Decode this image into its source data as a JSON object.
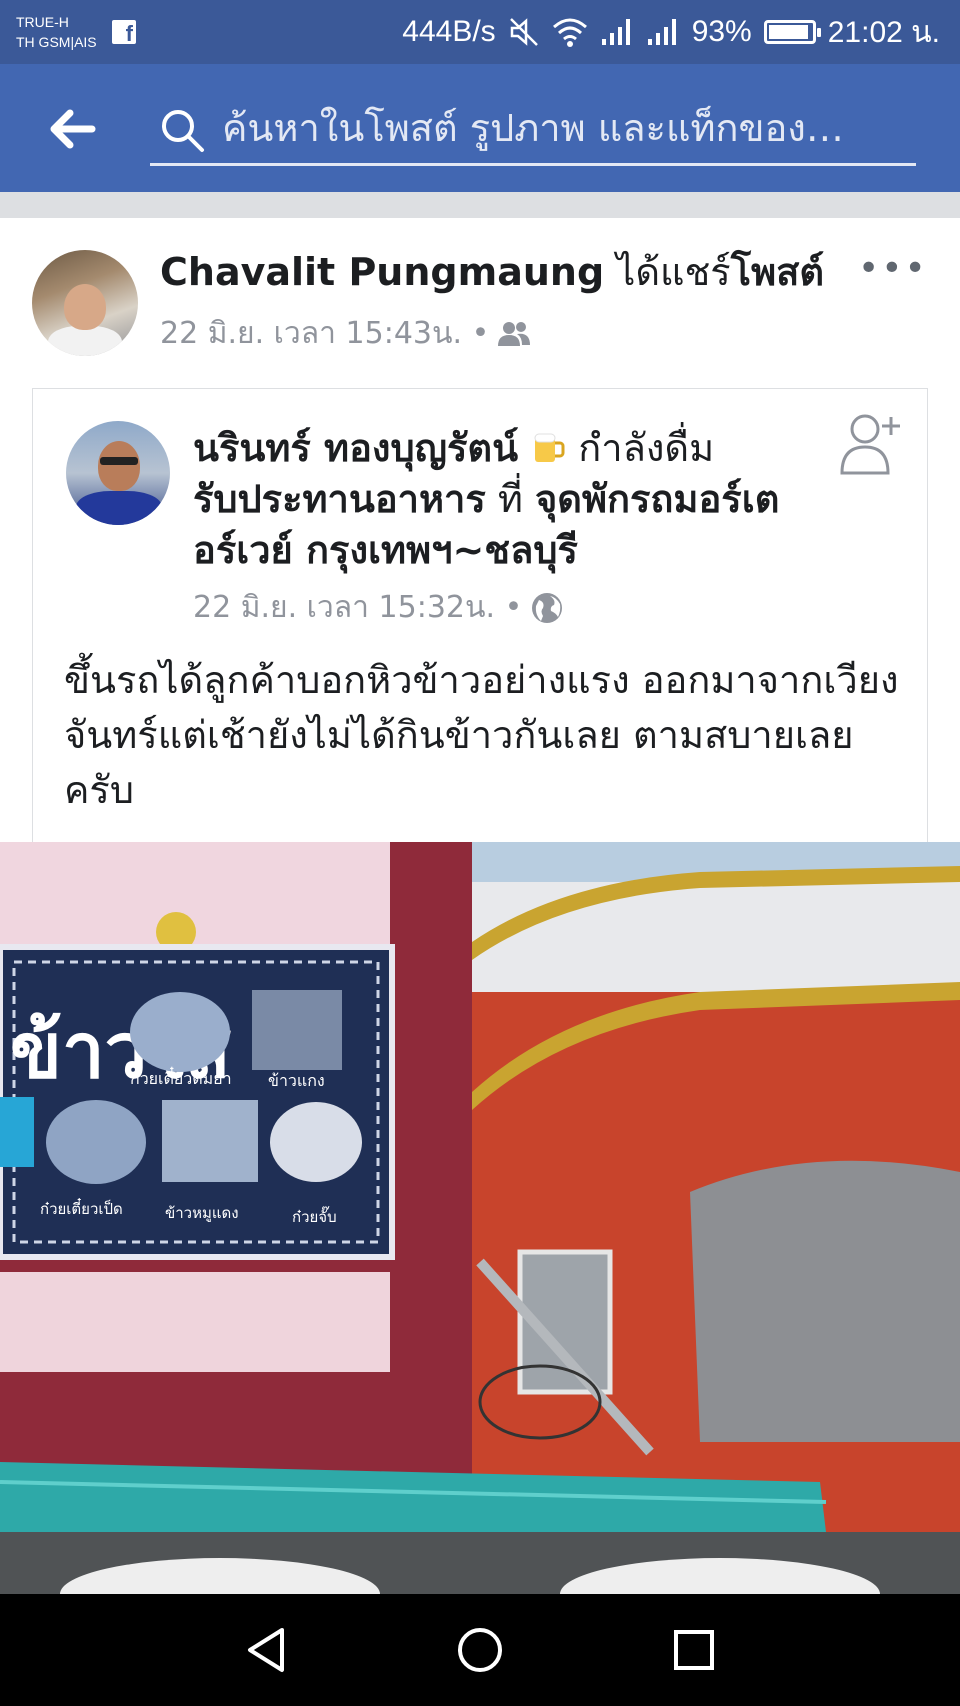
{
  "status_bar": {
    "carrier_line1": "TRUE-H",
    "carrier_line2": "TH GSM|AIS",
    "fb_glyph": "f",
    "net_speed": "444B/s",
    "battery_text": "93%",
    "battery_level": 0.93,
    "time": "21:02 น.",
    "icons": [
      "facebook-icon",
      "mute-icon",
      "wifi-icon",
      "signal-icon",
      "signal-icon",
      "battery-icon"
    ]
  },
  "header": {
    "search_placeholder": "ค้นหาในโพสต์ รูปภาพ และแท็กของ…",
    "color": "#4267b2"
  },
  "post": {
    "sharer": {
      "name": "Chavalit Pungmaung",
      "action_pre": " ได้แชร์",
      "action_obj": "โพสต์",
      "meta": "22 มิ.ย. เวลา 15:43น. •",
      "audience_icon": "friends-icon"
    },
    "more_label": "•••",
    "original": {
      "author": "นรินทร์ ทองบุญรัตน์",
      "activity": " กำลังดื่ม",
      "activity_obj": "รับประทานอาหาร",
      "at_word": " ที่ ",
      "place": "จุดพักรถมอร์เตอร์เวย์ กรุงเทพฯ~ชลบุรี",
      "meta": "22 มิ.ย. เวลา 15:32น. •",
      "audience_icon": "globe-icon",
      "body": "ขึ้นรถได้ลูกค้าบอกหิวข้าวอย่างแรง ออกมาจากเวียงจันทร์แต่เช้ายังไม่ได้กินข้าวกันเลย ตามสบายเลยครับ"
    },
    "photo": {
      "sign_title": "ข้าวใส",
      "sign_items": [
        "ก๋วยเตี๋ยวต้มยำ",
        "ข้าวแกง",
        "ก๋วยเตี๋ยวเป็ด",
        "ข้าวหมูแดง",
        "ก๋วยจั๊บ"
      ]
    }
  },
  "nav": {
    "icons": [
      "back-triangle-icon",
      "home-circle-icon",
      "recents-square-icon"
    ]
  }
}
